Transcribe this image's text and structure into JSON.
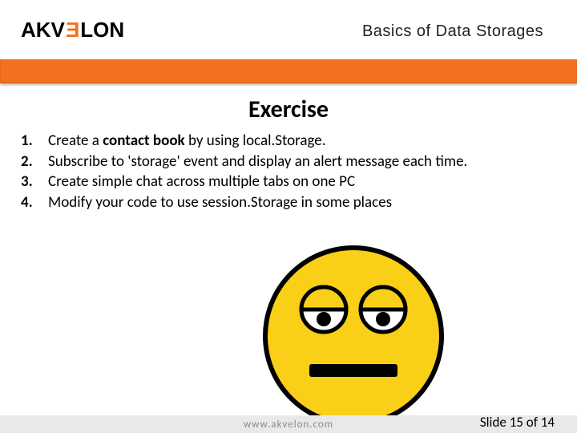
{
  "header": {
    "logo_part1": "AKV",
    "logo_e": "E",
    "logo_part2": "LON",
    "subtitle": "Basics of Data Storages"
  },
  "heading": "Exercise",
  "items": [
    {
      "num": "1.",
      "pre": "Create a ",
      "bold": "contact book",
      "post": " by using local.Storage."
    },
    {
      "num": "2.",
      "pre": "Subscribe to 'storage' event and display an alert message each time.",
      "bold": "",
      "post": ""
    },
    {
      "num": "3.",
      "pre": "Create simple chat across multiple tabs on one PC",
      "bold": "",
      "post": ""
    },
    {
      "num": "4.",
      "pre": "Modify your code to use session.Storage in some places",
      "bold": "",
      "post": ""
    }
  ],
  "footer": {
    "url": "www.akvelon.com",
    "slide_label": "Slide 15 of 14"
  }
}
